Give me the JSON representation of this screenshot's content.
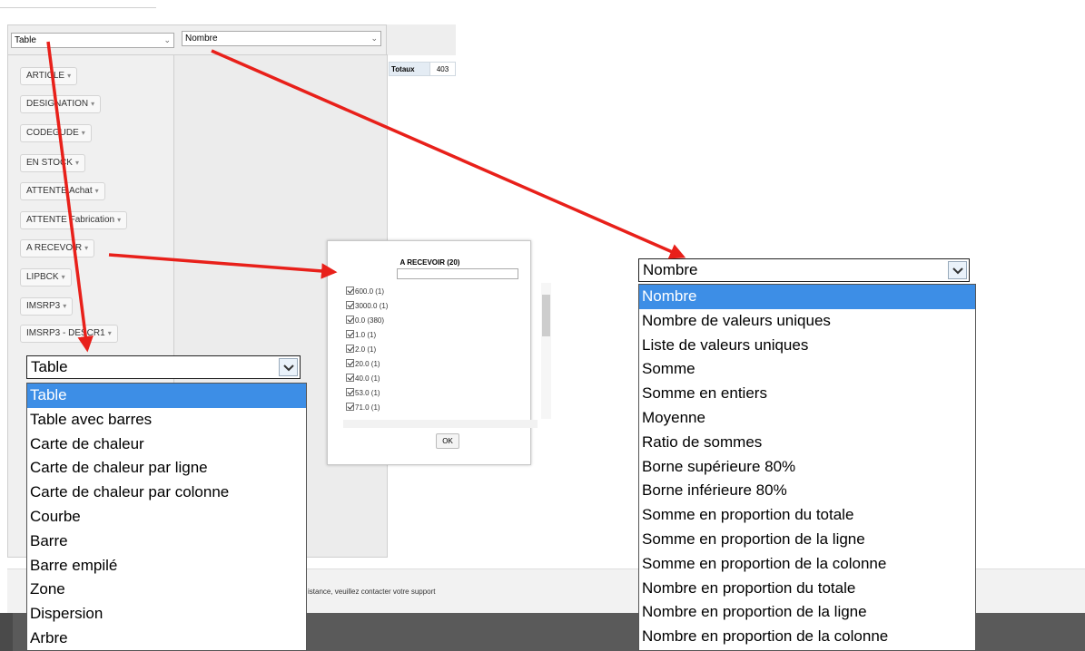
{
  "pivot": {
    "renderer_select": "Table",
    "aggregator_select": "Nombre",
    "totals_label": "Totaux",
    "totals_value": "403",
    "attributes": [
      "ARTICLE",
      "DESIGNATION",
      "CODEGUDE",
      "EN STOCK",
      "ATTENTE Achat",
      "ATTENTE Fabrication",
      "A RECEVOIR",
      "LIPBCK",
      "IMSRP3",
      "IMSRP3 - DESCR1"
    ]
  },
  "filter": {
    "title": "A RECEVOIR (20)",
    "search_placeholder": "",
    "items": [
      "600.0 (1)",
      "3000.0 (1)",
      "0.0 (380)",
      "1.0 (1)",
      "2.0 (1)",
      "20.0 (1)",
      "40.0 (1)",
      "53.0 (1)",
      "71.0 (1)"
    ],
    "ok_label": "OK"
  },
  "footer": {
    "text": "istance, veuillez contacter votre support"
  },
  "renderer_dropdown": {
    "selected": "Table",
    "options": [
      "Table",
      "Table avec barres",
      "Carte de chaleur",
      "Carte de chaleur par ligne",
      "Carte de chaleur par colonne",
      "Courbe",
      "Barre",
      "Barre empilé",
      "Zone",
      "Dispersion",
      "Arbre"
    ]
  },
  "aggregator_dropdown": {
    "selected": "Nombre",
    "options": [
      "Nombre",
      "Nombre de valeurs uniques",
      "Liste de valeurs uniques",
      "Somme",
      "Somme en entiers",
      "Moyenne",
      "Ratio de sommes",
      "Borne supérieure 80%",
      "Borne inférieure 80%",
      "Somme en proportion du totale",
      "Somme en proportion de la ligne",
      "Somme en proportion de la colonne",
      "Nombre en proportion du totale",
      "Nombre en proportion de la ligne",
      "Nombre en proportion de la colonne"
    ]
  },
  "colors": {
    "arrow": "#e8201a",
    "selected_option": "#3d8ee6"
  }
}
